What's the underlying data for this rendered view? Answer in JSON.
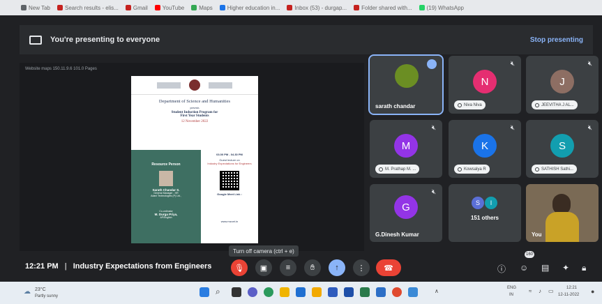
{
  "bookmarks": [
    {
      "label": "New Tab",
      "color": "#5f6368"
    },
    {
      "label": "Search results - elis...",
      "color": "#c5221f"
    },
    {
      "label": "Gmail",
      "color": "#c5221f"
    },
    {
      "label": "YouTube",
      "color": "#ff0000"
    },
    {
      "label": "Maps",
      "color": "#34a853"
    },
    {
      "label": "Higher education in...",
      "color": "#1a73e8"
    },
    {
      "label": "Inbox (53) - durgap...",
      "color": "#c5221f"
    },
    {
      "label": "Folder shared with...",
      "color": "#c5221f"
    },
    {
      "label": "(19) WhatsApp",
      "color": "#25d366"
    }
  ],
  "banner": {
    "text": "You're presenting to everyone",
    "stop_label": "Stop presenting"
  },
  "shared": {
    "toolbar_title": "Website maps 150.11.9.6 101.0 Pages",
    "poster": {
      "dept": "Department of Science and Humanities",
      "presents": "presents",
      "program": "Student Induction Program for",
      "program2": "First Year Students",
      "date": "12 November 2022",
      "resource_title": "Resource Person",
      "person_name": "Sarath Chandar S.",
      "person_role": "General Manager - HR",
      "person_org": "Adani Technologies (P) Ltd.,",
      "time": "03.00 PM - 04.30 PM",
      "topic_intro": "Guest lecture on",
      "topic": "Industry Expectations for Engineers",
      "meet": "Google Meet Link :",
      "coordinator_label": "Co-ordinator",
      "coordinator": "M. Durga Priya,",
      "coordinator_role": "AP/English",
      "site": "www.mzcet.in"
    }
  },
  "tiles": [
    {
      "name": "sarath chandar",
      "type": "video",
      "active": true
    },
    {
      "name": "Niva Niva",
      "initial": "N",
      "color": "#e52e71"
    },
    {
      "name": "JEEVITHA J AL...",
      "initial": "J",
      "color": "#8d6e63"
    },
    {
      "name": "M. Prathap M. ...",
      "initial": "M",
      "color": "#9334e6"
    },
    {
      "name": "Kowsalya R",
      "initial": "K",
      "color": "#1a73e8"
    },
    {
      "name": "SATHISH Sathi...",
      "initial": "S",
      "color": "#129eaf"
    },
    {
      "name": "G.Dinesh Kumar",
      "initial": "G",
      "color": "#9334e6"
    },
    {
      "name": "151 others",
      "initials": [
        "S",
        "I"
      ]
    },
    {
      "name": "You",
      "type": "video"
    }
  ],
  "bottom": {
    "time": "12:21 PM",
    "separator": "|",
    "meeting": "Industry Expectations from Engineers",
    "tooltip": "Turn off camera (ctrl + e)",
    "participant_count": "160"
  },
  "taskbar": {
    "temp": "23°C",
    "weather": "Partly sunny",
    "lang": "ENG",
    "region": "IN",
    "clock_time": "12:21",
    "clock_date": "12-11-2022"
  }
}
